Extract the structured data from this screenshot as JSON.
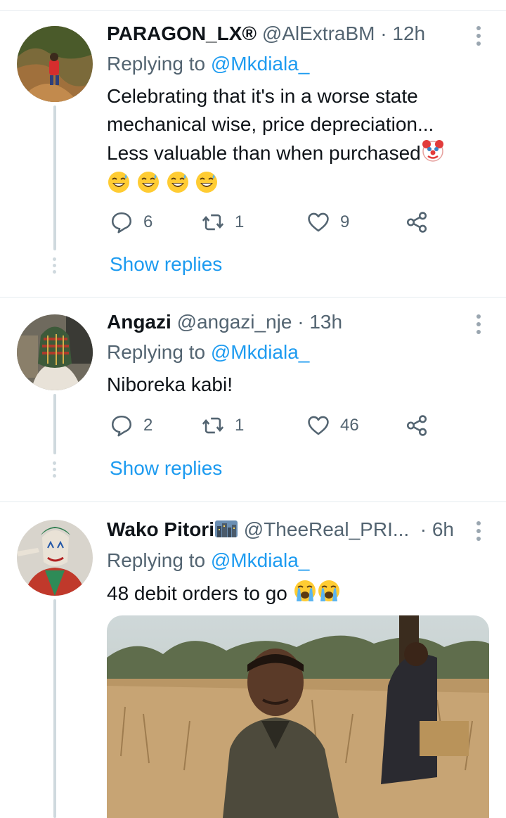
{
  "tweets": [
    {
      "name": "PARAGON_LX®",
      "handle": "@AlExtraBM",
      "time": "12h",
      "replying_label": "Replying to",
      "replying_to": "@Mkdiala_",
      "text_lines": [
        "Celebrating that it's in a worse state",
        "mechanical wise, price depreciation...",
        "Less valuable than when purchased"
      ],
      "emoji": [
        "clown-face",
        "grinning-sweat",
        "grinning-sweat",
        "grinning-sweat",
        "grinning-sweat"
      ],
      "replies": "6",
      "retweets": "1",
      "likes": "9",
      "show_replies": "Show replies"
    },
    {
      "name": "Angazi",
      "handle": "@angazi_nje",
      "time": "13h",
      "replying_label": "Replying to",
      "replying_to": "@Mkdiala_",
      "text": "Niboreka kabi!",
      "replies": "2",
      "retweets": "1",
      "likes": "46",
      "show_replies": "Show replies"
    },
    {
      "name": "Wako Pitori",
      "name_emoji": "cityscape",
      "handle": "@TheeReal_PRI...",
      "time": "6h",
      "replying_label": "Replying to",
      "replying_to": "@Mkdiala_",
      "text": "48 debit orders to go",
      "emoji": [
        "loudly-crying-face",
        "loudly-crying-face"
      ],
      "media": "photo of a crying man in a dry grass field with another man kneeling behind him"
    }
  ],
  "icons": {
    "reply": "reply-bubble-icon",
    "retweet": "retweet-icon",
    "like": "heart-icon",
    "share": "share-icon",
    "more": "more-vertical-icon"
  },
  "colors": {
    "link": "#1d9bf0",
    "secondary_text": "#536471",
    "thread_line": "#cfd9de"
  }
}
